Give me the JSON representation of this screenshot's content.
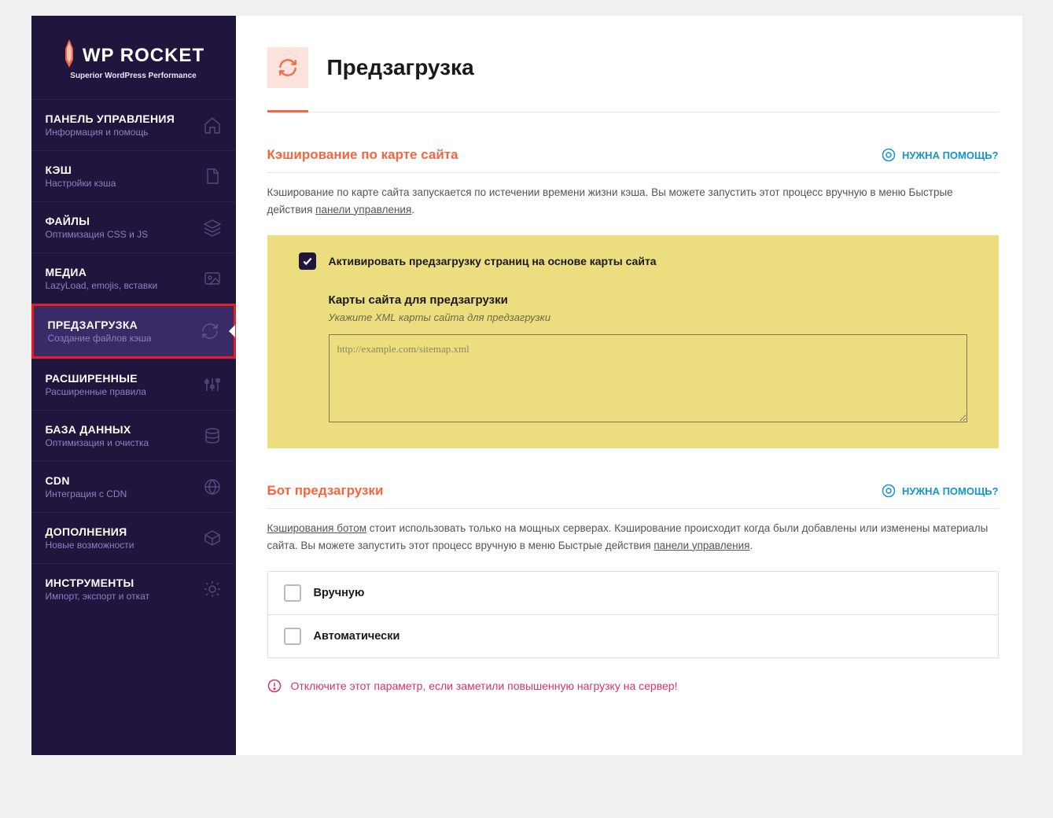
{
  "logo": {
    "brand": "WP ROCKET",
    "tagline": "Superior WordPress Performance"
  },
  "nav": [
    {
      "title": "ПАНЕЛЬ УПРАВЛЕНИЯ",
      "sub": "Информация и помощь",
      "icon": "home"
    },
    {
      "title": "КЭШ",
      "sub": "Настройки кэша",
      "icon": "file"
    },
    {
      "title": "ФАЙЛЫ",
      "sub": "Оптимизация CSS и JS",
      "icon": "layers"
    },
    {
      "title": "МЕДИА",
      "sub": "LazyLoad, emojis, вставки",
      "icon": "image"
    },
    {
      "title": "ПРЕДЗАГРУЗКА",
      "sub": "Создание файлов кэша",
      "icon": "preload",
      "active": true
    },
    {
      "title": "РАСШИРЕННЫЕ",
      "sub": "Расширенные правила",
      "icon": "sliders"
    },
    {
      "title": "БАЗА ДАННЫХ",
      "sub": "Оптимизация и очистка",
      "icon": "db"
    },
    {
      "title": "CDN",
      "sub": "Интеграция с CDN",
      "icon": "globe"
    },
    {
      "title": "ДОПОЛНЕНИЯ",
      "sub": "Новые возможности",
      "icon": "box"
    },
    {
      "title": "ИНСТРУМЕНТЫ",
      "sub": "Импорт, экспорт и откат",
      "icon": "tool"
    }
  ],
  "page": {
    "title": "Предзагрузка"
  },
  "help_label": "НУЖНА ПОМОЩЬ?",
  "sitemap": {
    "title": "Кэширование по карте сайта",
    "desc_pre": "Кэширование по карте сайта запускается по истечении времени жизни кэша. Вы можете запустить этот процесс вручную в меню Быстрые действия ",
    "desc_link": "панели управления",
    "desc_post": ".",
    "checkbox_label": "Активировать предзагрузку страниц на основе карты сайта",
    "sub_title": "Карты сайта для предзагрузки",
    "sub_hint": "Укажите XML карты сайта для предзагрузки",
    "placeholder": "http://example.com/sitemap.xml"
  },
  "bot": {
    "title": "Бот предзагрузки",
    "desc_link1": "Кэширования ботом",
    "desc_mid": " стоит использовать только на мощных серверах. Кэширование происходит когда были добавлены или изменены материалы сайта. Вы можете запустить этот процесс вручную в меню Быстрые действия ",
    "desc_link2": "панели управления",
    "desc_post": ".",
    "opt1": "Вручную",
    "opt2": "Автоматически",
    "warning": "Отключите этот параметр, если заметили повышенную нагрузку на сервер!"
  }
}
